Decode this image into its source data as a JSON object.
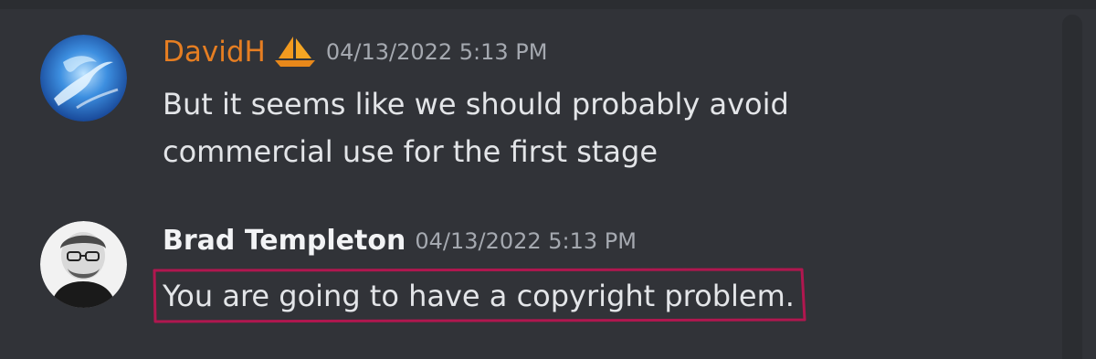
{
  "messages": [
    {
      "author": "DavidH",
      "author_color": "#e67e22",
      "badge_icon": "sailboat-icon",
      "timestamp": "04/13/2022 5:13 PM",
      "text": "But it seems like we should probably avoid commercial use for the first stage",
      "avatar_icon": "abstract-blue-avatar"
    },
    {
      "author": "Brad Templeton",
      "author_color": "#f2f3f5",
      "timestamp": "04/13/2022 5:13 PM",
      "text": "You are going to have a copyright problem.",
      "avatar_icon": "portrait-avatar",
      "highlight_color": "#b0174f"
    }
  ]
}
